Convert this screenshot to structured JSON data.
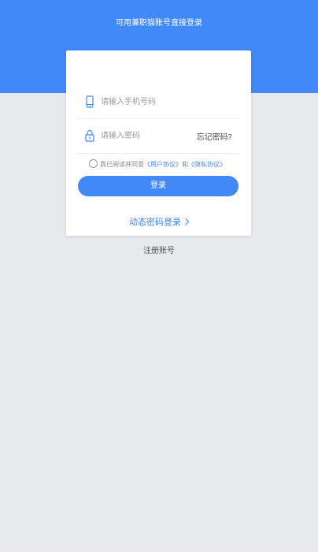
{
  "header": {
    "title": "可用兼职猫账号直接登录"
  },
  "form": {
    "phone_placeholder": "请输入手机号码",
    "password_placeholder": "请输入密码",
    "forgot_password": "忘记密码?",
    "agreement": {
      "prefix": "我已阅读并同意",
      "user_agreement": "《用户协议》",
      "and": "和",
      "privacy_agreement": "《隐私协议》"
    },
    "login_button": "登录",
    "dynamic_login": "动态密码登录"
  },
  "register": "注册账号",
  "icons": {
    "phone": "phone-icon",
    "lock": "lock-icon",
    "chevron": "chevron-right-icon"
  },
  "colors": {
    "primary": "#4189f8",
    "background": "#e8e9ec",
    "link": "#4a8ae8"
  }
}
